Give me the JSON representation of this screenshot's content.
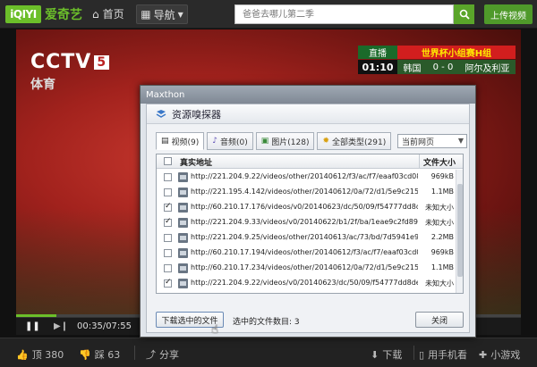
{
  "header": {
    "logo_box": "iQIYI",
    "logo_text": "爱奇艺",
    "home": "首页",
    "nav": "导航",
    "search_placeholder": "爸爸去哪儿第二季",
    "upload": "上传视频"
  },
  "video": {
    "channel": "CCTV",
    "channel_num": "5",
    "channel_sub": "体育",
    "score_live": "直播",
    "score_title": "世界杯小组赛H组",
    "score_time": "01:10",
    "team_home": "韩国",
    "score": "0 - 0",
    "team_away": "阿尔及利亚",
    "progress": 0.08
  },
  "controls": {
    "time": "00:35/07:55"
  },
  "bottombar": {
    "like": "顶 380",
    "dislike": "踩 63",
    "share": "分享",
    "download": "下载",
    "mobile": "用手机看",
    "games": "小游戏"
  },
  "dialog": {
    "window_title": "Maxthon",
    "heading": "资源嗅探器",
    "tabs": [
      {
        "label": "视频(9)",
        "active": true
      },
      {
        "label": "音频(0)",
        "active": false
      },
      {
        "label": "图片(128)",
        "active": false
      },
      {
        "label": "全部类型(291)",
        "active": false
      }
    ],
    "page_select": "当前网页",
    "col_url": "真实地址",
    "col_size": "文件大小",
    "rows": [
      {
        "checked": false,
        "url": "http://221.204.9.22/videos/other/20140612/f3/ac/f7/eaaf03cd088c5a6c1...",
        "size": "969kB"
      },
      {
        "checked": false,
        "url": "http://221.195.4.142/videos/other/20140612/0a/72/d1/5e9c215ce466bd...",
        "size": "1.1MB"
      },
      {
        "checked": true,
        "url": "http://60.210.17.176/videos/v0/20140623/dc/50/09/f54777dd8de65164...",
        "size": "未知大小"
      },
      {
        "checked": true,
        "url": "http://221.204.9.33/videos/v0/20140622/b1/2f/ba/1eae9c2fd898c6f2b1...",
        "size": "未知大小"
      },
      {
        "checked": false,
        "url": "http://221.204.9.25/videos/other/20140613/ac/73/bd/7d5941e9a8ec913...",
        "size": "2.2MB"
      },
      {
        "checked": false,
        "url": "http://60.210.17.194/videos/other/20140612/f3/ac/f7/eaaf03cd088c5a6c...",
        "size": "969kB"
      },
      {
        "checked": false,
        "url": "http://60.210.17.234/videos/other/20140612/0a/72/d1/5e9c215ce466bd...",
        "size": "1.1MB"
      },
      {
        "checked": true,
        "url": "http://221.204.9.22/videos/v0/20140623/dc/50/09/f54777dd8de65164a...",
        "size": "未知大小"
      }
    ],
    "download_button": "下载选中的文件",
    "selected_count": "选中的文件数目: 3",
    "close_button": "关闭"
  }
}
